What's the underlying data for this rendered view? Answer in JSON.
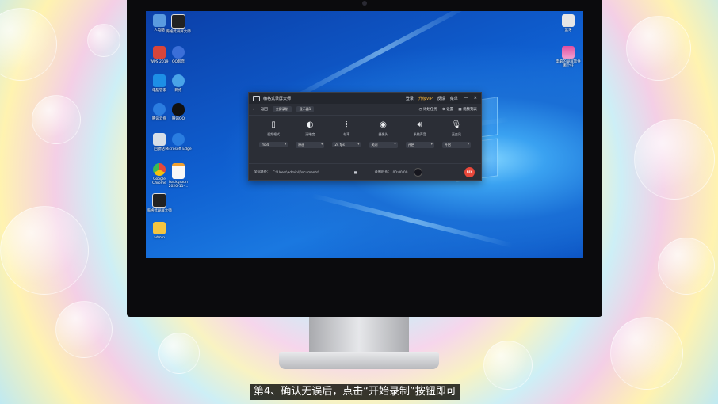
{
  "subtitle": "第4、确认无误后，点击“开始录制”按钮即可",
  "desktop_icons_left": [
    {
      "label": "人电脑",
      "icon": "computer-icon",
      "color": "#5a9be0"
    },
    {
      "label": "WPS 2019",
      "icon": "wps-icon",
      "color": "#d8453a"
    },
    {
      "label": "电脑管家",
      "icon": "shield-icon",
      "color": "#1d8fe6"
    },
    {
      "label": "腾讯云盘",
      "icon": "cloud-s-icon",
      "color": "#2b7de0"
    },
    {
      "label": "回收站",
      "icon": "recycle-bin-icon",
      "color": "#d7dfe8"
    },
    {
      "label": "Google Chrome",
      "icon": "chrome-icon",
      "color": "#e5493a"
    },
    {
      "label": "嗨格式录屏大师",
      "icon": "recorder-icon",
      "color": "#222222"
    },
    {
      "label": "admin",
      "icon": "folder-icon",
      "color": "#f4c542"
    }
  ],
  "desktop_icons_left2": [
    {
      "label": "嗨格式录屏大师",
      "icon": "recorder-icon",
      "color": "#222222"
    },
    {
      "label": "QQ影音",
      "icon": "video-player-icon",
      "color": "#3b6fd8"
    },
    {
      "label": "网络",
      "icon": "network-globe-icon",
      "color": "#49a3e8"
    },
    {
      "label": "腾讯QQ",
      "icon": "qq-penguin-icon",
      "color": "#111111"
    },
    {
      "label": "Microsoft Edge",
      "icon": "edge-icon",
      "color": "#2a7de0"
    },
    {
      "label": "backgroun 2020-11-...",
      "icon": "image-file-icon",
      "color": "#f7f7f7"
    }
  ],
  "desktop_icons_right": [
    {
      "label": "蓝牙",
      "icon": "document-icon",
      "color": "#e6e6e6"
    },
    {
      "label": "电脑的录屏软件哪个好",
      "icon": "image-file-icon",
      "color": "#e04fa0"
    }
  ],
  "app": {
    "title": "嗨格式录屏大师",
    "menu": [
      "登录",
      "升级VIP",
      "反馈",
      "菜单"
    ],
    "vip_color": "#f5b53c",
    "minimize": "—",
    "close": "✕",
    "back_label": "返回",
    "mode_select": "全屏录制",
    "screen_select": "显示器1",
    "right_tools": [
      "计划任务",
      "设置",
      "视频列表"
    ],
    "modules": [
      {
        "label": "视频格式",
        "value": "mp4",
        "icon": "file-icon",
        "glyph": "▯"
      },
      {
        "label": "清晰度",
        "value": "原画",
        "icon": "contrast-icon",
        "glyph": "◐"
      },
      {
        "label": "帧率",
        "value": "24 fps",
        "icon": "audio-wave-icon",
        "glyph": "⦙"
      },
      {
        "label": "摄像头",
        "value": "关闭",
        "icon": "camera-icon",
        "glyph": "◉"
      },
      {
        "label": "系统声音",
        "value": "开启",
        "icon": "speaker-icon",
        "glyph": "🔊︎"
      },
      {
        "label": "麦克风",
        "value": "开启",
        "icon": "microphone-icon",
        "glyph": "🎙︎"
      }
    ],
    "footer_path_label": "保存路径：",
    "footer_path": "C:\\Users\\admin\\Documents\\",
    "footer_timer_label": "录制时长：",
    "footer_timer": "00:00:00",
    "rec_label": "REC"
  }
}
